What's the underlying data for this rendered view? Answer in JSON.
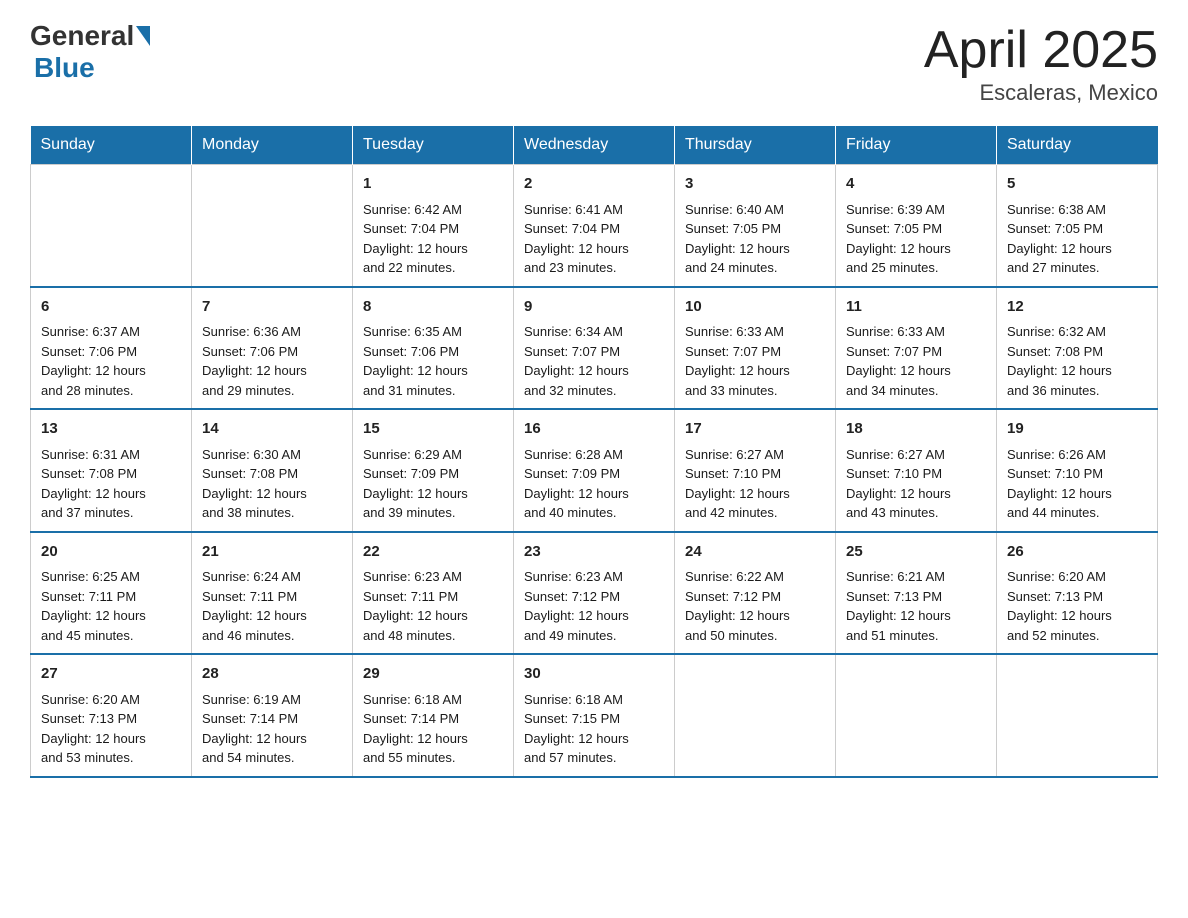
{
  "header": {
    "logo_general": "General",
    "logo_blue": "Blue",
    "title": "April 2025",
    "subtitle": "Escaleras, Mexico"
  },
  "days_of_week": [
    "Sunday",
    "Monday",
    "Tuesday",
    "Wednesday",
    "Thursday",
    "Friday",
    "Saturday"
  ],
  "weeks": [
    [
      {
        "day": "",
        "info": ""
      },
      {
        "day": "",
        "info": ""
      },
      {
        "day": "1",
        "info": "Sunrise: 6:42 AM\nSunset: 7:04 PM\nDaylight: 12 hours\nand 22 minutes."
      },
      {
        "day": "2",
        "info": "Sunrise: 6:41 AM\nSunset: 7:04 PM\nDaylight: 12 hours\nand 23 minutes."
      },
      {
        "day": "3",
        "info": "Sunrise: 6:40 AM\nSunset: 7:05 PM\nDaylight: 12 hours\nand 24 minutes."
      },
      {
        "day": "4",
        "info": "Sunrise: 6:39 AM\nSunset: 7:05 PM\nDaylight: 12 hours\nand 25 minutes."
      },
      {
        "day": "5",
        "info": "Sunrise: 6:38 AM\nSunset: 7:05 PM\nDaylight: 12 hours\nand 27 minutes."
      }
    ],
    [
      {
        "day": "6",
        "info": "Sunrise: 6:37 AM\nSunset: 7:06 PM\nDaylight: 12 hours\nand 28 minutes."
      },
      {
        "day": "7",
        "info": "Sunrise: 6:36 AM\nSunset: 7:06 PM\nDaylight: 12 hours\nand 29 minutes."
      },
      {
        "day": "8",
        "info": "Sunrise: 6:35 AM\nSunset: 7:06 PM\nDaylight: 12 hours\nand 31 minutes."
      },
      {
        "day": "9",
        "info": "Sunrise: 6:34 AM\nSunset: 7:07 PM\nDaylight: 12 hours\nand 32 minutes."
      },
      {
        "day": "10",
        "info": "Sunrise: 6:33 AM\nSunset: 7:07 PM\nDaylight: 12 hours\nand 33 minutes."
      },
      {
        "day": "11",
        "info": "Sunrise: 6:33 AM\nSunset: 7:07 PM\nDaylight: 12 hours\nand 34 minutes."
      },
      {
        "day": "12",
        "info": "Sunrise: 6:32 AM\nSunset: 7:08 PM\nDaylight: 12 hours\nand 36 minutes."
      }
    ],
    [
      {
        "day": "13",
        "info": "Sunrise: 6:31 AM\nSunset: 7:08 PM\nDaylight: 12 hours\nand 37 minutes."
      },
      {
        "day": "14",
        "info": "Sunrise: 6:30 AM\nSunset: 7:08 PM\nDaylight: 12 hours\nand 38 minutes."
      },
      {
        "day": "15",
        "info": "Sunrise: 6:29 AM\nSunset: 7:09 PM\nDaylight: 12 hours\nand 39 minutes."
      },
      {
        "day": "16",
        "info": "Sunrise: 6:28 AM\nSunset: 7:09 PM\nDaylight: 12 hours\nand 40 minutes."
      },
      {
        "day": "17",
        "info": "Sunrise: 6:27 AM\nSunset: 7:10 PM\nDaylight: 12 hours\nand 42 minutes."
      },
      {
        "day": "18",
        "info": "Sunrise: 6:27 AM\nSunset: 7:10 PM\nDaylight: 12 hours\nand 43 minutes."
      },
      {
        "day": "19",
        "info": "Sunrise: 6:26 AM\nSunset: 7:10 PM\nDaylight: 12 hours\nand 44 minutes."
      }
    ],
    [
      {
        "day": "20",
        "info": "Sunrise: 6:25 AM\nSunset: 7:11 PM\nDaylight: 12 hours\nand 45 minutes."
      },
      {
        "day": "21",
        "info": "Sunrise: 6:24 AM\nSunset: 7:11 PM\nDaylight: 12 hours\nand 46 minutes."
      },
      {
        "day": "22",
        "info": "Sunrise: 6:23 AM\nSunset: 7:11 PM\nDaylight: 12 hours\nand 48 minutes."
      },
      {
        "day": "23",
        "info": "Sunrise: 6:23 AM\nSunset: 7:12 PM\nDaylight: 12 hours\nand 49 minutes."
      },
      {
        "day": "24",
        "info": "Sunrise: 6:22 AM\nSunset: 7:12 PM\nDaylight: 12 hours\nand 50 minutes."
      },
      {
        "day": "25",
        "info": "Sunrise: 6:21 AM\nSunset: 7:13 PM\nDaylight: 12 hours\nand 51 minutes."
      },
      {
        "day": "26",
        "info": "Sunrise: 6:20 AM\nSunset: 7:13 PM\nDaylight: 12 hours\nand 52 minutes."
      }
    ],
    [
      {
        "day": "27",
        "info": "Sunrise: 6:20 AM\nSunset: 7:13 PM\nDaylight: 12 hours\nand 53 minutes."
      },
      {
        "day": "28",
        "info": "Sunrise: 6:19 AM\nSunset: 7:14 PM\nDaylight: 12 hours\nand 54 minutes."
      },
      {
        "day": "29",
        "info": "Sunrise: 6:18 AM\nSunset: 7:14 PM\nDaylight: 12 hours\nand 55 minutes."
      },
      {
        "day": "30",
        "info": "Sunrise: 6:18 AM\nSunset: 7:15 PM\nDaylight: 12 hours\nand 57 minutes."
      },
      {
        "day": "",
        "info": ""
      },
      {
        "day": "",
        "info": ""
      },
      {
        "day": "",
        "info": ""
      }
    ]
  ]
}
